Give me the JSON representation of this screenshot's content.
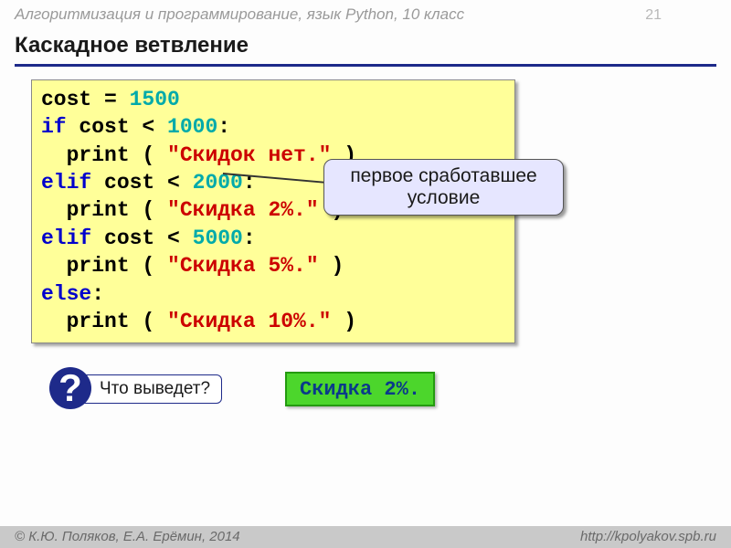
{
  "header": {
    "course": "Алгоритмизация и программирование, язык Python, 10 класс",
    "slide_number": "21"
  },
  "title": "Каскадное ветвление",
  "code": {
    "l1_a": "cost = ",
    "l1_num": "1500",
    "l2_kw": "if",
    "l2_a": " cost < ",
    "l2_num": "1000",
    "l2_b": ":",
    "l3_a": "  print ( ",
    "l3_str": "\"Скидок нет.\"",
    "l3_b": " )",
    "l4_kw": "elif",
    "l4_a": " cost < ",
    "l4_num": "2000",
    "l4_b": ":",
    "l5_a": "  print ( ",
    "l5_str": "\"Скидка 2%.\"",
    "l5_b": " )",
    "l6_kw": "elif",
    "l6_a": " cost < ",
    "l6_num": "5000",
    "l6_b": ":",
    "l7_a": "  print ( ",
    "l7_str": "\"Скидка 5%.\"",
    "l7_b": " )",
    "l8_kw": "else",
    "l8_a": ":",
    "l9_a": "  print ( ",
    "l9_str": "\"Скидка 10%.\"",
    "l9_b": " )"
  },
  "callout": "первое сработавшее условие",
  "question_mark": "?",
  "question": "Что выведет?",
  "answer": "Скидка 2%.",
  "footer": {
    "authors": "К.Ю. Поляков, Е.А. Ерёмин, 2014",
    "copyright": "© ",
    "url": "http://kpolyakov.spb.ru"
  }
}
